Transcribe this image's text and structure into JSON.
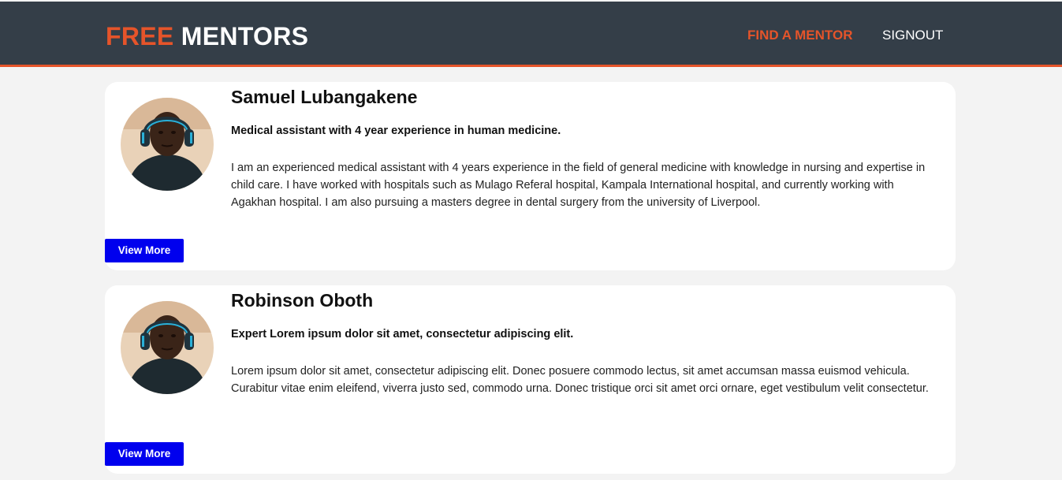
{
  "header": {
    "brand_part1": "FREE",
    "brand_part2": "MENTORS",
    "nav": {
      "find_mentor": "FIND A MENTOR",
      "signout": "SIGNOUT"
    }
  },
  "colors": {
    "navbar_bg": "#343e48",
    "accent": "#e5542a",
    "button_bg": "#0000ee",
    "page_bg": "#f3f3f3"
  },
  "mentors": [
    {
      "name": "Samuel Lubangakene",
      "headline": "Medical assistant with 4 year experience in human medicine.",
      "bio": "I am an experienced medical assistant with 4 years experience in the field of general medicine with knowledge in nursing and expertise in child care. I have worked with hospitals such as Mulago Referal hospital, Kampala International hospital, and currently working with Agakhan hospital. I am also pursuing a masters degree in dental surgery from the university of Liverpool.",
      "button_label": "View More"
    },
    {
      "name": "Robinson Oboth",
      "headline": "Expert Lorem ipsum dolor sit amet, consectetur adipiscing elit.",
      "bio": "Lorem ipsum dolor sit amet, consectetur adipiscing elit. Donec posuere commodo lectus, sit amet accumsan massa euismod vehicula. Curabitur vitae enim eleifend, viverra justo sed, commodo urna. Donec tristique orci sit amet orci ornare, eget vestibulum velit consectetur.",
      "button_label": "View More"
    }
  ]
}
